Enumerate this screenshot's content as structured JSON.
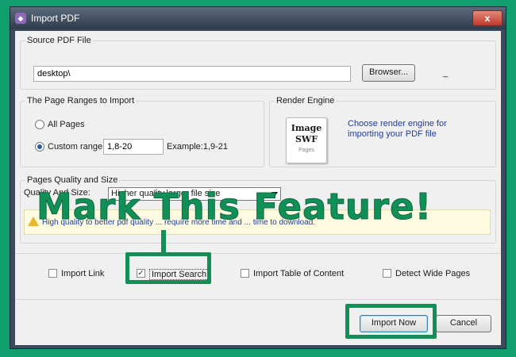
{
  "window": {
    "title": "Import PDF",
    "close_glyph": "x"
  },
  "source": {
    "group_title": "Source PDF File",
    "path_value": "desktop\\",
    "browse_label": "Browser...",
    "trailing": "_"
  },
  "ranges": {
    "group_title": "The Page Ranges to Import",
    "all_pages_label": "All Pages",
    "custom_range_label": "Custom range:",
    "custom_range_value": "1,8-20",
    "example_text": "Example:1,9-21",
    "selected": "custom"
  },
  "render": {
    "group_title": "Render Engine",
    "book_line1": "Image",
    "book_line2": "SWF",
    "book_small": "Pages",
    "description": "Choose render engine for importing your PDF file"
  },
  "quality": {
    "group_title": "Pages Quality and Size",
    "label": "Quality And Size:",
    "selected_option": "Higher quality,larger file size",
    "info_text": "High quality to better pdf quality ... require more time and ... time to download."
  },
  "options": {
    "import_link": {
      "label": "Import Link",
      "checked": false
    },
    "import_search": {
      "label": "Import Search",
      "checked": true
    },
    "import_toc": {
      "label": "Import Table of Content",
      "checked": false
    },
    "detect_wide": {
      "label": "Detect Wide Pages",
      "checked": false
    }
  },
  "footer": {
    "import_now_label": "Import Now",
    "cancel_label": "Cancel"
  },
  "annotation": {
    "text": "Mark This Feature!",
    "color": "#128f57"
  }
}
